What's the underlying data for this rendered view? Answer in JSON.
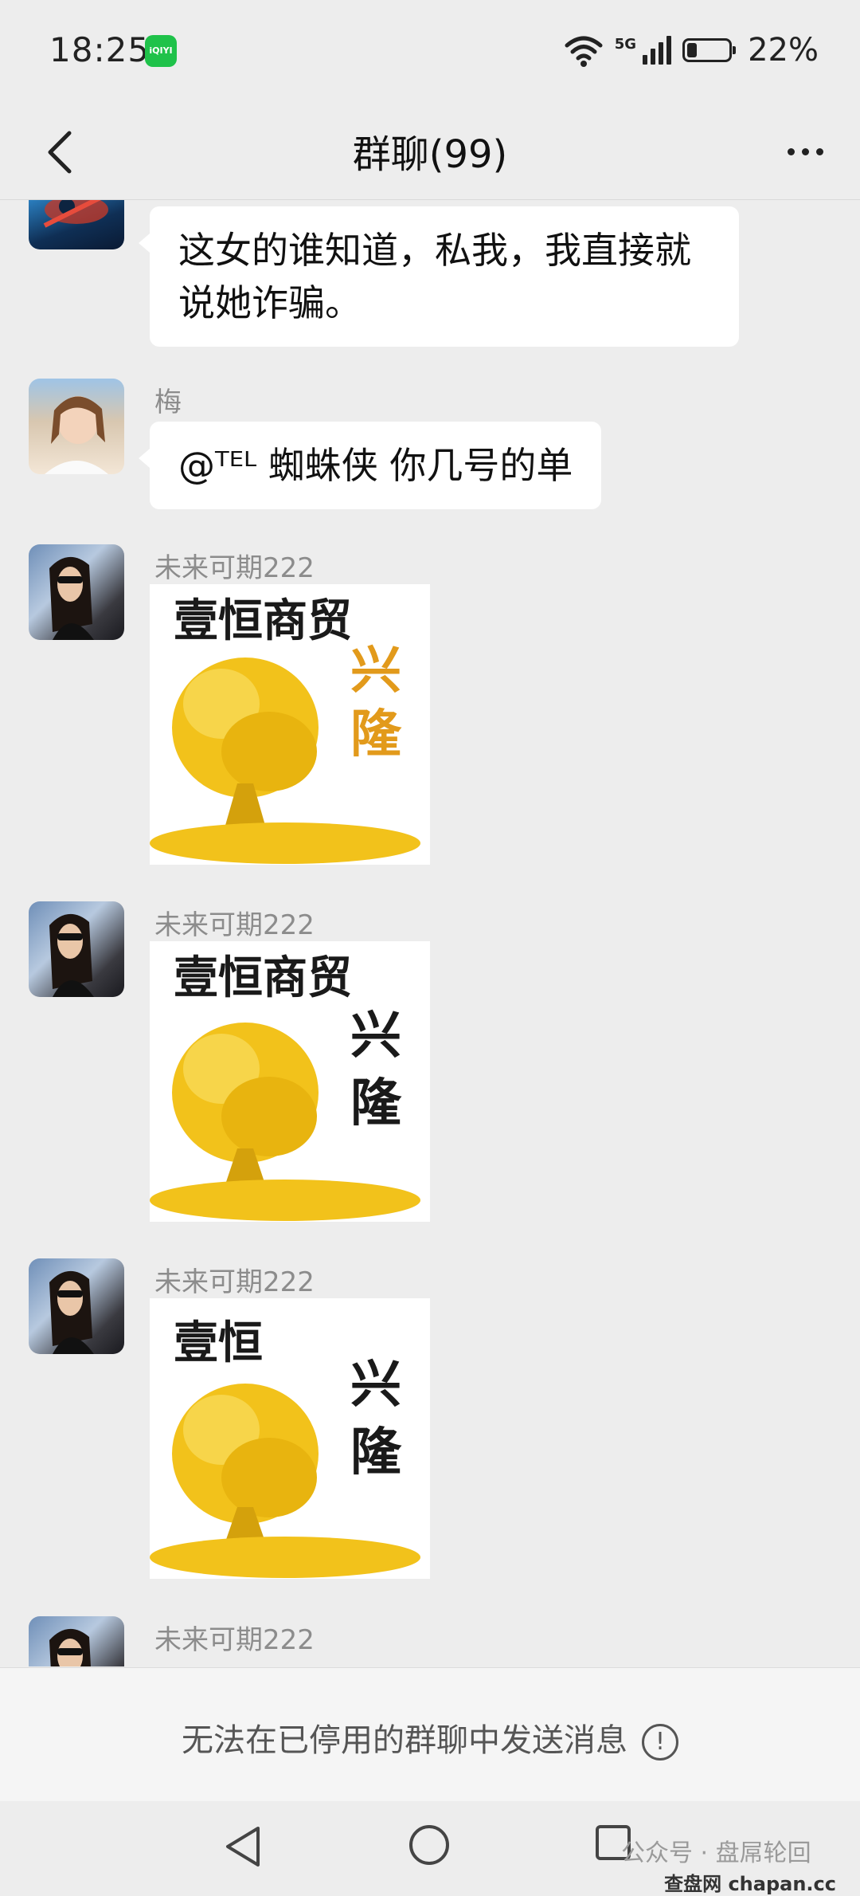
{
  "status_bar": {
    "time": "18:25",
    "app_badge": "iQIYI",
    "network": "5G",
    "battery": "22%"
  },
  "header": {
    "title": "群聊(99)"
  },
  "messages": [
    {
      "sender": "",
      "text": "这女的谁知道，私我，我直接就说她诈骗。"
    },
    {
      "sender": "梅",
      "text": "@ᵀᴱᴸ 蜘蛛侠  你几号的单"
    },
    {
      "sender": "未来可期222",
      "sticker_main": "壹恒商贸",
      "sticker_side": "兴隆"
    },
    {
      "sender": "未来可期222",
      "sticker_main": "壹恒商贸",
      "sticker_side": "兴隆"
    },
    {
      "sender": "未来可期222",
      "sticker_main": "壹恒",
      "sticker_side": "兴隆"
    },
    {
      "sender": "未来可期222"
    }
  ],
  "footer": {
    "disabled_notice": "无法在已停用的群聊中发送消息",
    "info_icon": "!"
  },
  "watermark": {
    "left": "公众号 · 盘屌轮回",
    "right": "查盘网 chapan.cc"
  },
  "colors": {
    "background": "#ededed",
    "bubble": "#ffffff",
    "sender_text": "#8c8c8c",
    "gold": "#f2c21b"
  }
}
